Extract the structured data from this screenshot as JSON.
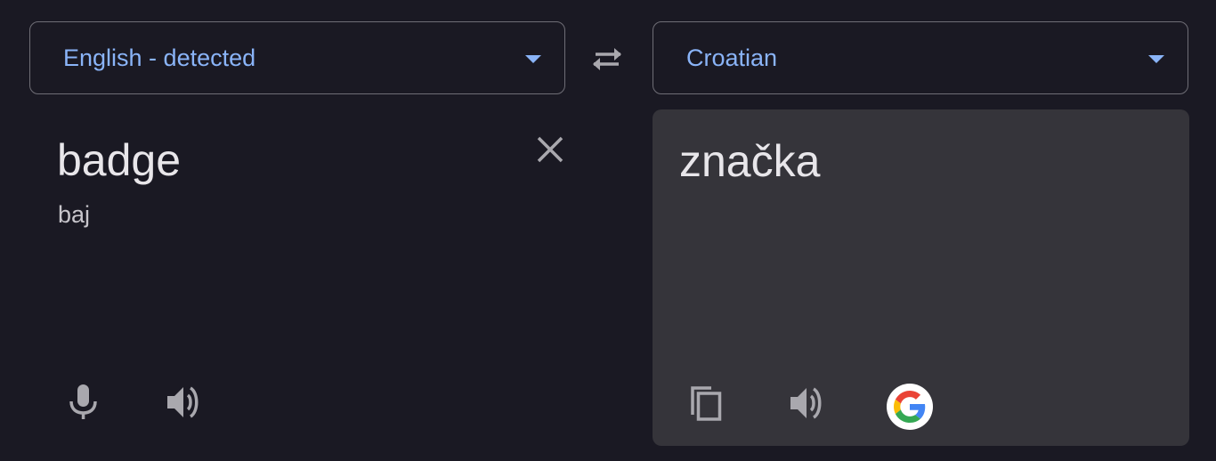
{
  "source": {
    "language_label": "English - detected",
    "text": "badge",
    "transliteration": "baj"
  },
  "target": {
    "language_label": "Croatian",
    "text": "značka"
  },
  "icons": {
    "source_dropdown": "chevron-down-icon",
    "swap": "swap-languages-icon",
    "clear": "close-icon",
    "mic": "microphone-icon",
    "source_listen": "speaker-icon",
    "copy": "copy-icon",
    "target_listen": "speaker-icon",
    "google": "google-logo-icon"
  },
  "colors": {
    "background": "#1a1923",
    "accent": "#8ab4f8",
    "output_panel": "#35343a",
    "icon": "#a9a8ae"
  }
}
